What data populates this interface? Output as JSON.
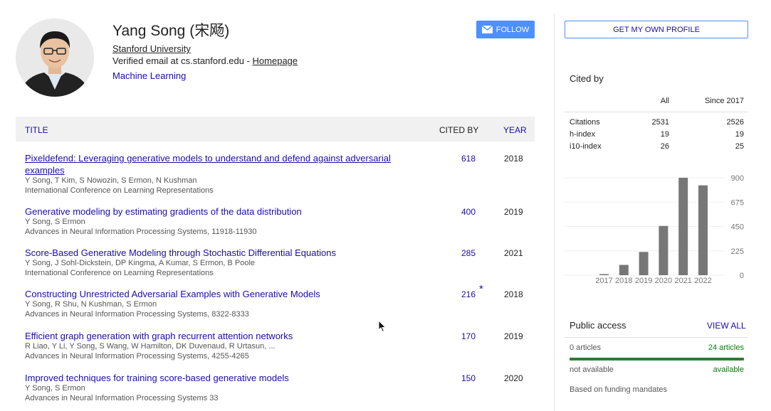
{
  "profile": {
    "name": "Yang Song (宋飏)",
    "affiliation": "Stanford University",
    "email_text": "Verified email at cs.stanford.edu - ",
    "homepage": "Homepage",
    "interest": "Machine Learning",
    "follow_label": "FOLLOW"
  },
  "table": {
    "col_title": "TITLE",
    "col_cited": "CITED BY",
    "col_year": "YEAR",
    "rows": [
      {
        "title": "Pixeldefend: Leveraging generative models to understand and defend against adversarial examples",
        "authors": "Y Song, T Kim, S Nowozin, S Ermon, N Kushman",
        "venue": "International Conference on Learning Representations",
        "cited": "618",
        "year": "2018"
      },
      {
        "title": "Generative modeling by estimating gradients of the data distribution",
        "authors": "Y Song, S Ermon",
        "venue": "Advances in Neural Information Processing Systems, 11918-11930",
        "cited": "400",
        "year": "2019"
      },
      {
        "title": "Score-Based Generative Modeling through Stochastic Differential Equations",
        "authors": "Y Song, J Sohl-Dickstein, DP Kingma, A Kumar, S Ermon, B Poole",
        "venue": "International Conference on Learning Representations",
        "cited": "285",
        "year": "2021"
      },
      {
        "title": "Constructing Unrestricted Adversarial Examples with Generative Models",
        "authors": "Y Song, R Shu, N Kushman, S Ermon",
        "venue": "Advances in Neural Information Processing Systems, 8322-8333",
        "cited": "216",
        "year": "2018",
        "star": "*"
      },
      {
        "title": "Efficient graph generation with graph recurrent attention networks",
        "authors": "R Liao, Y Li, Y Song, S Wang, W Hamilton, DK Duvenaud, R Urtasun, ...",
        "venue": "Advances in Neural Information Processing Systems, 4255-4265",
        "cited": "170",
        "year": "2019"
      },
      {
        "title": "Improved techniques for training score-based generative models",
        "authors": "Y Song, S Ermon",
        "venue": "Advances in Neural Information Processing Systems 33",
        "cited": "150",
        "year": "2020"
      }
    ]
  },
  "sidebar": {
    "own_profile": "GET MY OWN PROFILE",
    "cited_by": {
      "title": "Cited by",
      "col_all": "All",
      "col_since": "Since 2017",
      "rows": [
        {
          "label": "Citations",
          "all": "2531",
          "since": "2526"
        },
        {
          "label": "h-index",
          "all": "19",
          "since": "19"
        },
        {
          "label": "i10-index",
          "all": "26",
          "since": "25"
        }
      ]
    },
    "public_access": {
      "title": "Public access",
      "view_all": "VIEW ALL",
      "left_count": "0 articles",
      "right_count": "24 articles",
      "left_status": "not available",
      "right_status": "available",
      "note": "Based on funding mandates",
      "available_fraction": 1.0
    }
  },
  "chart_data": {
    "type": "bar",
    "categories": [
      "2017",
      "2018",
      "2019",
      "2020",
      "2021",
      "2022"
    ],
    "values": [
      10,
      95,
      215,
      455,
      900,
      830
    ],
    "yticks": [
      "900",
      "675",
      "450",
      "225",
      "0"
    ],
    "ylim": [
      0,
      900
    ]
  },
  "colors": {
    "link": "#1a0dab",
    "button": "#4d90fe",
    "bar": "#777777",
    "available": "#2e7d32"
  }
}
